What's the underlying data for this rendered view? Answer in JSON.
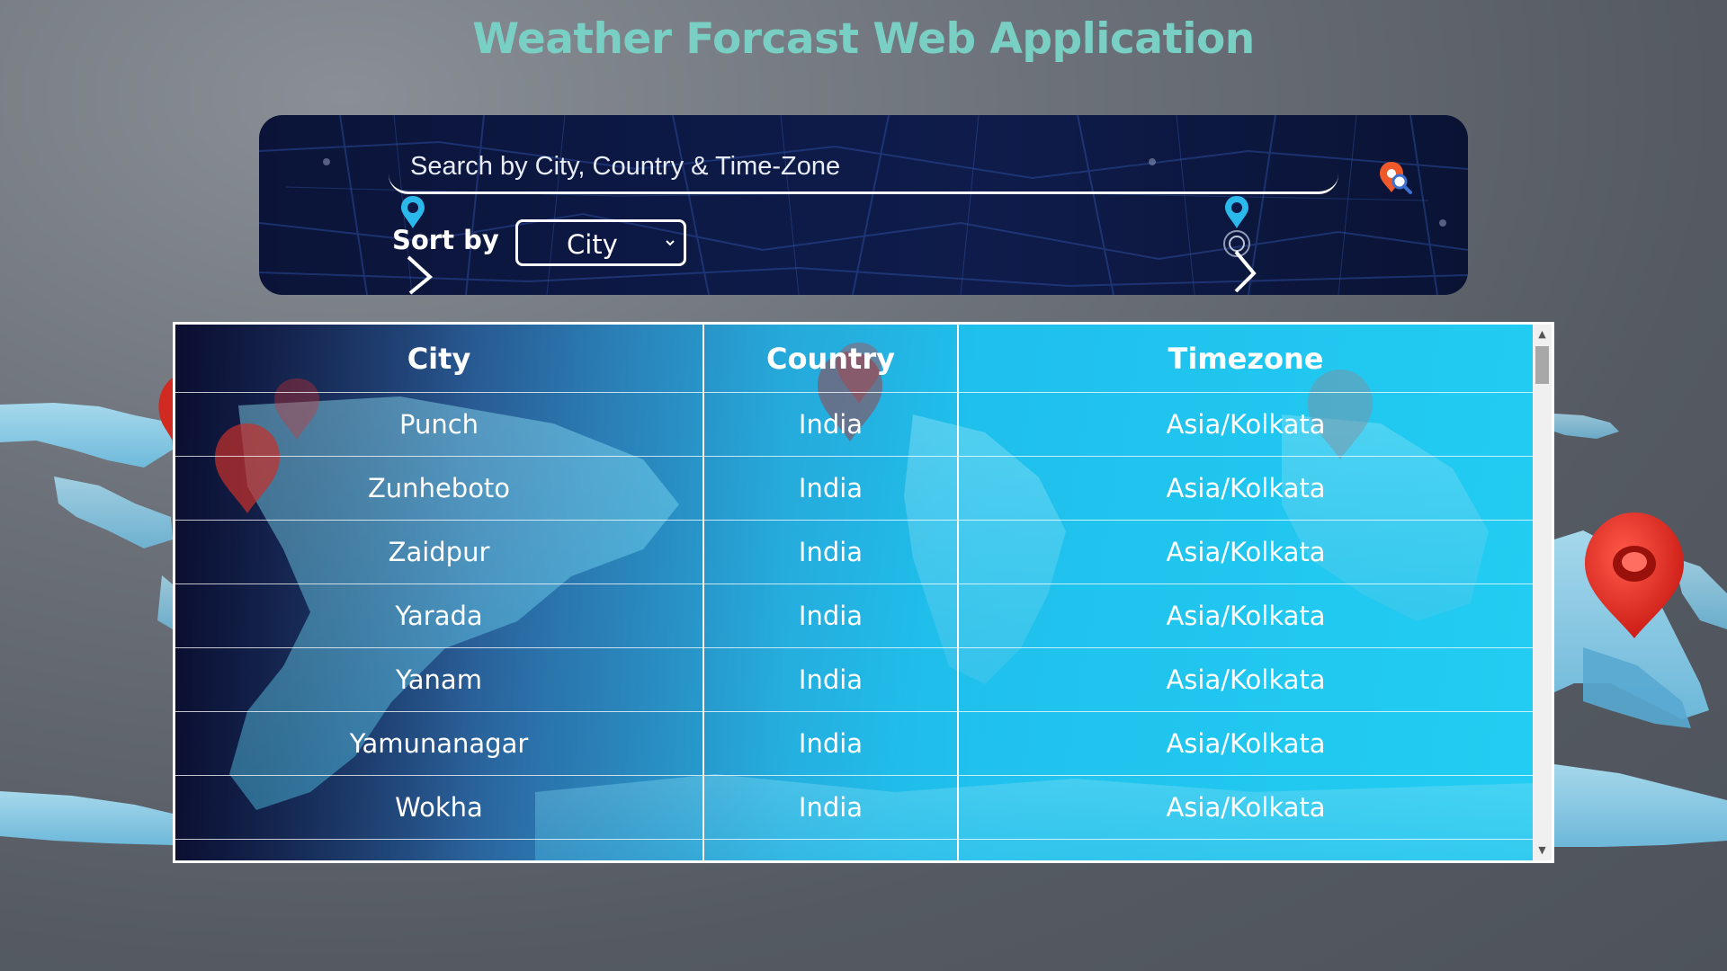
{
  "page": {
    "title": "Weather Forcast Web Application"
  },
  "search": {
    "placeholder": "Search by City, Country & Time-Zone",
    "value": "",
    "icon": "location-search-icon"
  },
  "sort": {
    "label": "Sort by",
    "selected": "City"
  },
  "table": {
    "headers": [
      "City",
      "Country",
      "Timezone"
    ],
    "rows": [
      [
        "Punch",
        "India",
        "Asia/Kolkata"
      ],
      [
        "Zunheboto",
        "India",
        "Asia/Kolkata"
      ],
      [
        "Zaidpur",
        "India",
        "Asia/Kolkata"
      ],
      [
        "Yarada",
        "India",
        "Asia/Kolkata"
      ],
      [
        "Yanam",
        "India",
        "Asia/Kolkata"
      ],
      [
        "Yamunanagar",
        "India",
        "Asia/Kolkata"
      ],
      [
        "Wokha",
        "India",
        "Asia/Kolkata"
      ]
    ]
  },
  "colors": {
    "title": "#79cfc4",
    "panel": "#0d1a47",
    "table_accent": "#22cdf2",
    "map_pin": "#e0261f"
  }
}
